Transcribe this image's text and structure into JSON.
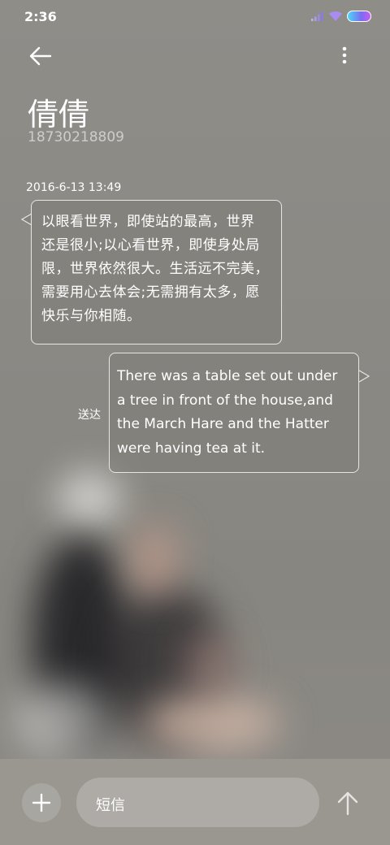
{
  "status_bar": {
    "time": "2:36",
    "icons": [
      "signal-icon",
      "wifi-icon",
      "battery-icon"
    ]
  },
  "header": {
    "back_icon": "arrow-left-icon",
    "more_icon": "more-vertical-icon",
    "contact_name": "倩倩",
    "contact_number": "18730218809"
  },
  "conversation": {
    "timestamp": "2016-6-13 13:49",
    "messages": [
      {
        "direction": "incoming",
        "lines": [
          "以眼看世界，即使站的最高，世界",
          "还是很小;以心看世界，即使身处局",
          "限，世界依然很大。生活远不完美，",
          "需要用心去体会;无需拥有太多，愿",
          "快乐与你相随。"
        ]
      },
      {
        "direction": "outgoing",
        "status": "送达",
        "lines": [
          "There was a table set out under",
          "a tree in front of the house,and",
          "the March Hare and the Hatter",
          "were having tea at it."
        ]
      }
    ]
  },
  "composer": {
    "add_icon": "plus-icon",
    "placeholder": "短信",
    "send_icon": "arrow-up-icon"
  },
  "colors": {
    "background": "#8b8984",
    "bottom_bar": "#9a9791",
    "input_bg": "#aeaba6",
    "battery_gradient_start": "#4dd8f5",
    "battery_gradient_end": "#c85cf0"
  }
}
